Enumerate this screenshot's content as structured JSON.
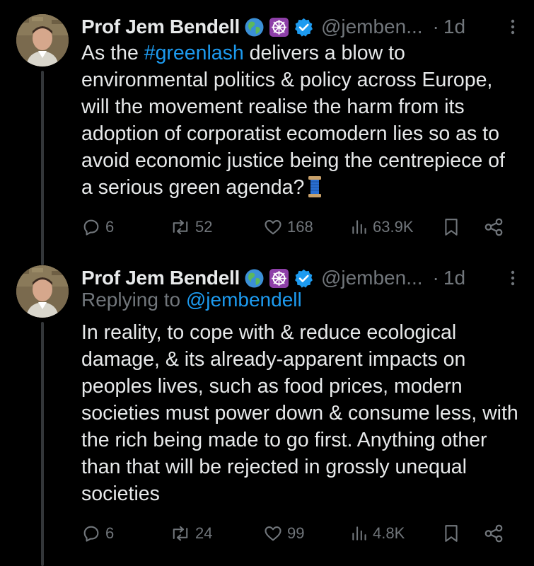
{
  "tweets": [
    {
      "author": {
        "display_name": "Prof Jem Bendell",
        "handle": "@jemben...",
        "badges": [
          "globe-emoji",
          "dharma-wheel-emoji",
          "verified-badge"
        ],
        "avatar_icon": "profile-photo"
      },
      "separator": "·",
      "time": "1d",
      "text_before": "As the ",
      "hashtag": "#greenlash",
      "text_after": " delivers a blow to environmental politics & policy across Europe, will the movement realise the harm from its adoption of corporatist ecomodern lies so as to avoid economic justice being the centrepiece of a serious green agenda?",
      "trailing_icon": "thread-spool-emoji",
      "stats": {
        "replies": "6",
        "reposts": "52",
        "likes": "168",
        "views": "63.9K"
      }
    },
    {
      "author": {
        "display_name": "Prof Jem Bendell",
        "handle": "@jemben...",
        "badges": [
          "globe-emoji",
          "dharma-wheel-emoji",
          "verified-badge"
        ],
        "avatar_icon": "profile-photo"
      },
      "separator": "·",
      "time": "1d",
      "replying_to_label": "Replying to",
      "replying_to_handle": "@jembendell",
      "text": "In reality, to cope with & reduce ecological damage, & its already-apparent impacts on peoples lives, such as food prices, modern societies must power down & consume less, with the rich being made to go first. Anything other than that will be rejected in grossly unequal societies",
      "stats": {
        "replies": "6",
        "reposts": "24",
        "likes": "99",
        "views": "4.8K"
      }
    }
  ],
  "colors": {
    "background": "#000000",
    "text": "#e7e9ea",
    "muted": "#71767b",
    "link": "#1d9bf0",
    "verified": "#1d9bf0"
  }
}
